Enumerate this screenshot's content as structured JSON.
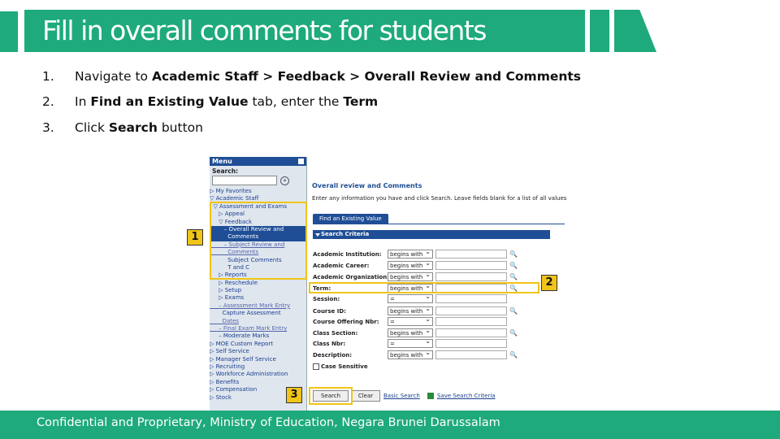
{
  "title": "Fill in overall comments for students",
  "steps": [
    {
      "num": "1.",
      "parts": [
        "Navigate to ",
        "Academic Staff > Feedback > Overall Review and Comments",
        ""
      ]
    },
    {
      "num": "2.",
      "parts": [
        "In ",
        "Find an Existing Value",
        " tab, enter the ",
        "Term"
      ]
    },
    {
      "num": "3.",
      "parts": [
        "Click ",
        "Search",
        " button"
      ]
    }
  ],
  "menu": {
    "header": "Menu",
    "search_label": "Search:",
    "items": [
      {
        "label": "▷ My Favorites",
        "style": "lnk"
      },
      {
        "label": "▽ Academic Staff",
        "style": "lnk"
      },
      {
        "label": "  ▽ Assessment and Exams",
        "style": "lnk"
      },
      {
        "label": "     ▷ Appeal",
        "style": "lnk"
      },
      {
        "label": "     ▽ Feedback",
        "style": "lnk"
      },
      {
        "label": "        – Overall Review and",
        "style": "sel"
      },
      {
        "label": "          Comments",
        "style": "sel"
      },
      {
        "label": "        – Subject Review and",
        "style": "sub"
      },
      {
        "label": "          Comments",
        "style": "sub"
      },
      {
        "label": "          Subject Comments",
        "style": "lnk"
      },
      {
        "label": "          T and C",
        "style": "lnk"
      },
      {
        "label": "     ▷ Reports",
        "style": "lnk"
      },
      {
        "label": "     ▷ Reschedule",
        "style": "lnk"
      },
      {
        "label": "     ▷ Setup",
        "style": "lnk"
      },
      {
        "label": "     ▷ Exams",
        "style": "lnk"
      },
      {
        "label": "     – Assessment Mark Entry",
        "style": "sub"
      },
      {
        "label": "       Capture Assessment",
        "style": "lnk"
      },
      {
        "label": "       Dates",
        "style": "sub"
      },
      {
        "label": "     – Final Exam Mark Entry",
        "style": "sub"
      },
      {
        "label": "     – Moderate Marks",
        "style": "lnk"
      },
      {
        "label": "▷ MOE Custom Report",
        "style": "lnk"
      },
      {
        "label": "▷ Self Service",
        "style": "lnk"
      },
      {
        "label": "▷ Manager Self Service",
        "style": "lnk"
      },
      {
        "label": "▷ Recruiting",
        "style": "lnk"
      },
      {
        "label": "▷ Workforce Administration",
        "style": "lnk"
      },
      {
        "label": "▷ Benefits",
        "style": "lnk"
      },
      {
        "label": "▷ Compensation",
        "style": "lnk"
      },
      {
        "label": "▷ Stock",
        "style": "lnk"
      }
    ]
  },
  "pane": {
    "title": "Overall review and Comments",
    "instructions": "Enter any information you have and click Search. Leave fields blank for a list of all values",
    "tab_label": "Find an Existing Value",
    "criteria_label": "Search Criteria",
    "fields": [
      {
        "label": "Academic Institution:",
        "op": "begins with"
      },
      {
        "label": "Academic Career:",
        "op": "begins with"
      },
      {
        "label": "Academic Organization:",
        "op": "begins with"
      },
      {
        "label": "Term:",
        "op": "begins with"
      },
      {
        "label": "Session:",
        "op": "="
      },
      {
        "label": "Course ID:",
        "op": "begins with"
      },
      {
        "label": "Course Offering Nbr:",
        "op": "="
      },
      {
        "label": "Class Section:",
        "op": "begins with"
      },
      {
        "label": "Class Nbr:",
        "op": "="
      },
      {
        "label": "Description:",
        "op": "begins with"
      }
    ],
    "case_sensitive_label": "Case Sensitive",
    "search_button": "Search",
    "clear_button": "Clear",
    "basic_search_link": "Basic Search",
    "save_criteria_link": "Save Search Criteria"
  },
  "callouts": [
    "1",
    "2",
    "3"
  ],
  "footer": "Confidential and Proprietary, Ministry of Education, Negara Brunei Darussalam",
  "colors": {
    "accent": "#1eaa7c",
    "highlight": "#f0c419",
    "ps_blue": "#1f4e96"
  }
}
